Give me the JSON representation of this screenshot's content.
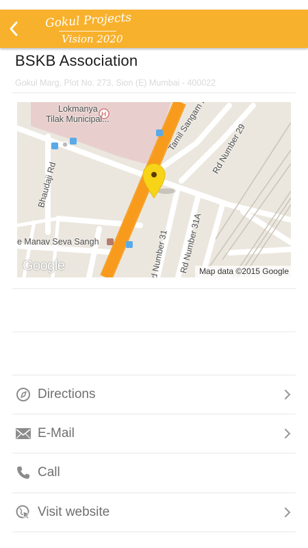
{
  "header": {
    "logo_line1": "Gokul Projects",
    "logo_line2": "Vision 2020",
    "accent_color": "#f8b12c",
    "back_icon": "chevron-left-icon"
  },
  "place": {
    "name": "BSKB Association",
    "address": "Gokul Marg, Plot No. 273, Sion (E) Mumbai - 400022"
  },
  "map": {
    "labels": {
      "hospital_line1": "Lokmanya",
      "hospital_line2": "Tilak Municipal...",
      "tamil_sangam": "Tamil Sangam Road",
      "rd29": "Rd Number 29",
      "bhaudaji": "Bhaudaji Rd",
      "manav_seva": "e Manav Seva Sangh",
      "rd31": "d Number 31",
      "rd31a": "Rd Number 31A"
    },
    "google": "Google",
    "attribution": "Map data ©2015 Google",
    "marker_color": "#f7d417",
    "highway_color": "#f89a1c"
  },
  "actions": [
    {
      "label": "Directions",
      "icon": "compass-icon",
      "chevron": true
    },
    {
      "label": "E-Mail",
      "icon": "envelope-icon",
      "chevron": true
    },
    {
      "label": "Call",
      "icon": "phone-icon",
      "chevron": false
    },
    {
      "label": "Visit website",
      "icon": "globe-cursor-icon",
      "chevron": true
    }
  ]
}
